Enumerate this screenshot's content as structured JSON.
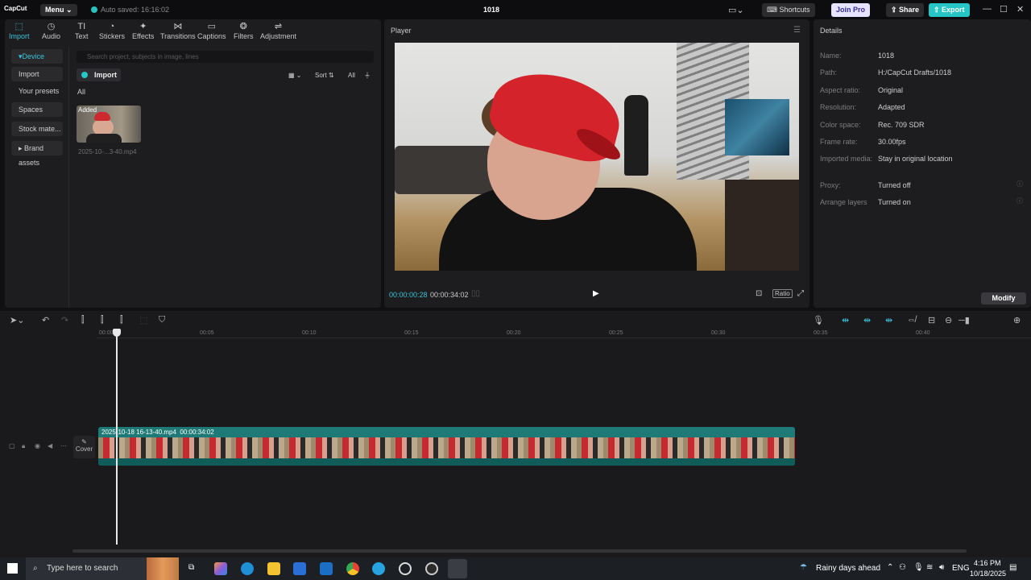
{
  "titlebar": {
    "app_name": "CapCut",
    "menu_label": "Menu",
    "autosave_text": "Auto saved: 16:16:02",
    "project_title": "1018",
    "shortcuts_label": "Shortcuts",
    "joinpro_label": "Join Pro",
    "share_label": "Share",
    "export_label": "Export"
  },
  "toolbar": {
    "items": [
      {
        "label": "Import",
        "icon": "import-icon"
      },
      {
        "label": "Audio",
        "icon": "audio-icon"
      },
      {
        "label": "Text",
        "icon": "text-icon"
      },
      {
        "label": "Stickers",
        "icon": "stickers-icon"
      },
      {
        "label": "Effects",
        "icon": "effects-icon"
      },
      {
        "label": "Transitions",
        "icon": "transitions-icon"
      },
      {
        "label": "Captions",
        "icon": "captions-icon"
      },
      {
        "label": "Filters",
        "icon": "filters-icon"
      },
      {
        "label": "Adjustment",
        "icon": "adjustment-icon"
      }
    ]
  },
  "sidebar": {
    "items": [
      {
        "label": "Device"
      },
      {
        "label": "Import"
      },
      {
        "label": "Your presets"
      },
      {
        "label": "Spaces"
      },
      {
        "label": "Stock mate..."
      },
      {
        "label": "Brand assets"
      }
    ]
  },
  "media": {
    "search_placeholder": "Search project, subjects in image, lines",
    "import_label": "Import",
    "sort_label": "Sort",
    "filter_all_label": "All",
    "tab_all": "All",
    "item_badge": "Added",
    "item_name": "2025-10-...3-40.mp4"
  },
  "player": {
    "title": "Player",
    "current_time": "00:00:00:28",
    "total_time": "00:00:34:02",
    "ratio_label": "Ratio"
  },
  "details": {
    "title": "Details",
    "rows": [
      {
        "label": "Name:",
        "value": "1018"
      },
      {
        "label": "Path:",
        "value": "H:/CapCut Drafts/1018"
      },
      {
        "label": "Aspect ratio:",
        "value": "Original"
      },
      {
        "label": "Resolution:",
        "value": "Adapted"
      },
      {
        "label": "Color space:",
        "value": "Rec. 709 SDR"
      },
      {
        "label": "Frame rate:",
        "value": "30.00fps"
      },
      {
        "label": "Imported media:",
        "value": "Stay in original location"
      },
      {
        "label": "Proxy:",
        "value": "Turned off"
      },
      {
        "label": "Arrange layers",
        "value": "Turned on"
      }
    ],
    "modify_label": "Modify"
  },
  "timeline": {
    "ruler_ticks": [
      "00:00",
      "00:05",
      "00:10",
      "00:15",
      "00:20",
      "00:25",
      "00:30",
      "00:35",
      "00:40"
    ],
    "clip_name": "2025-10-18 16-13-40.mp4",
    "clip_duration": "00:00:34:02",
    "cover_label": "Cover"
  },
  "taskbar": {
    "search_placeholder": "Type here to search",
    "weather": "Rainy days ahead",
    "language": "ENG",
    "time": "4:16 PM",
    "date": "10/18/2025"
  },
  "colors": {
    "accent": "#26c6c6",
    "active_tab": "#39c5d8",
    "clip": "#1e7a76",
    "joinpro_bg": "#e6e3ff"
  }
}
